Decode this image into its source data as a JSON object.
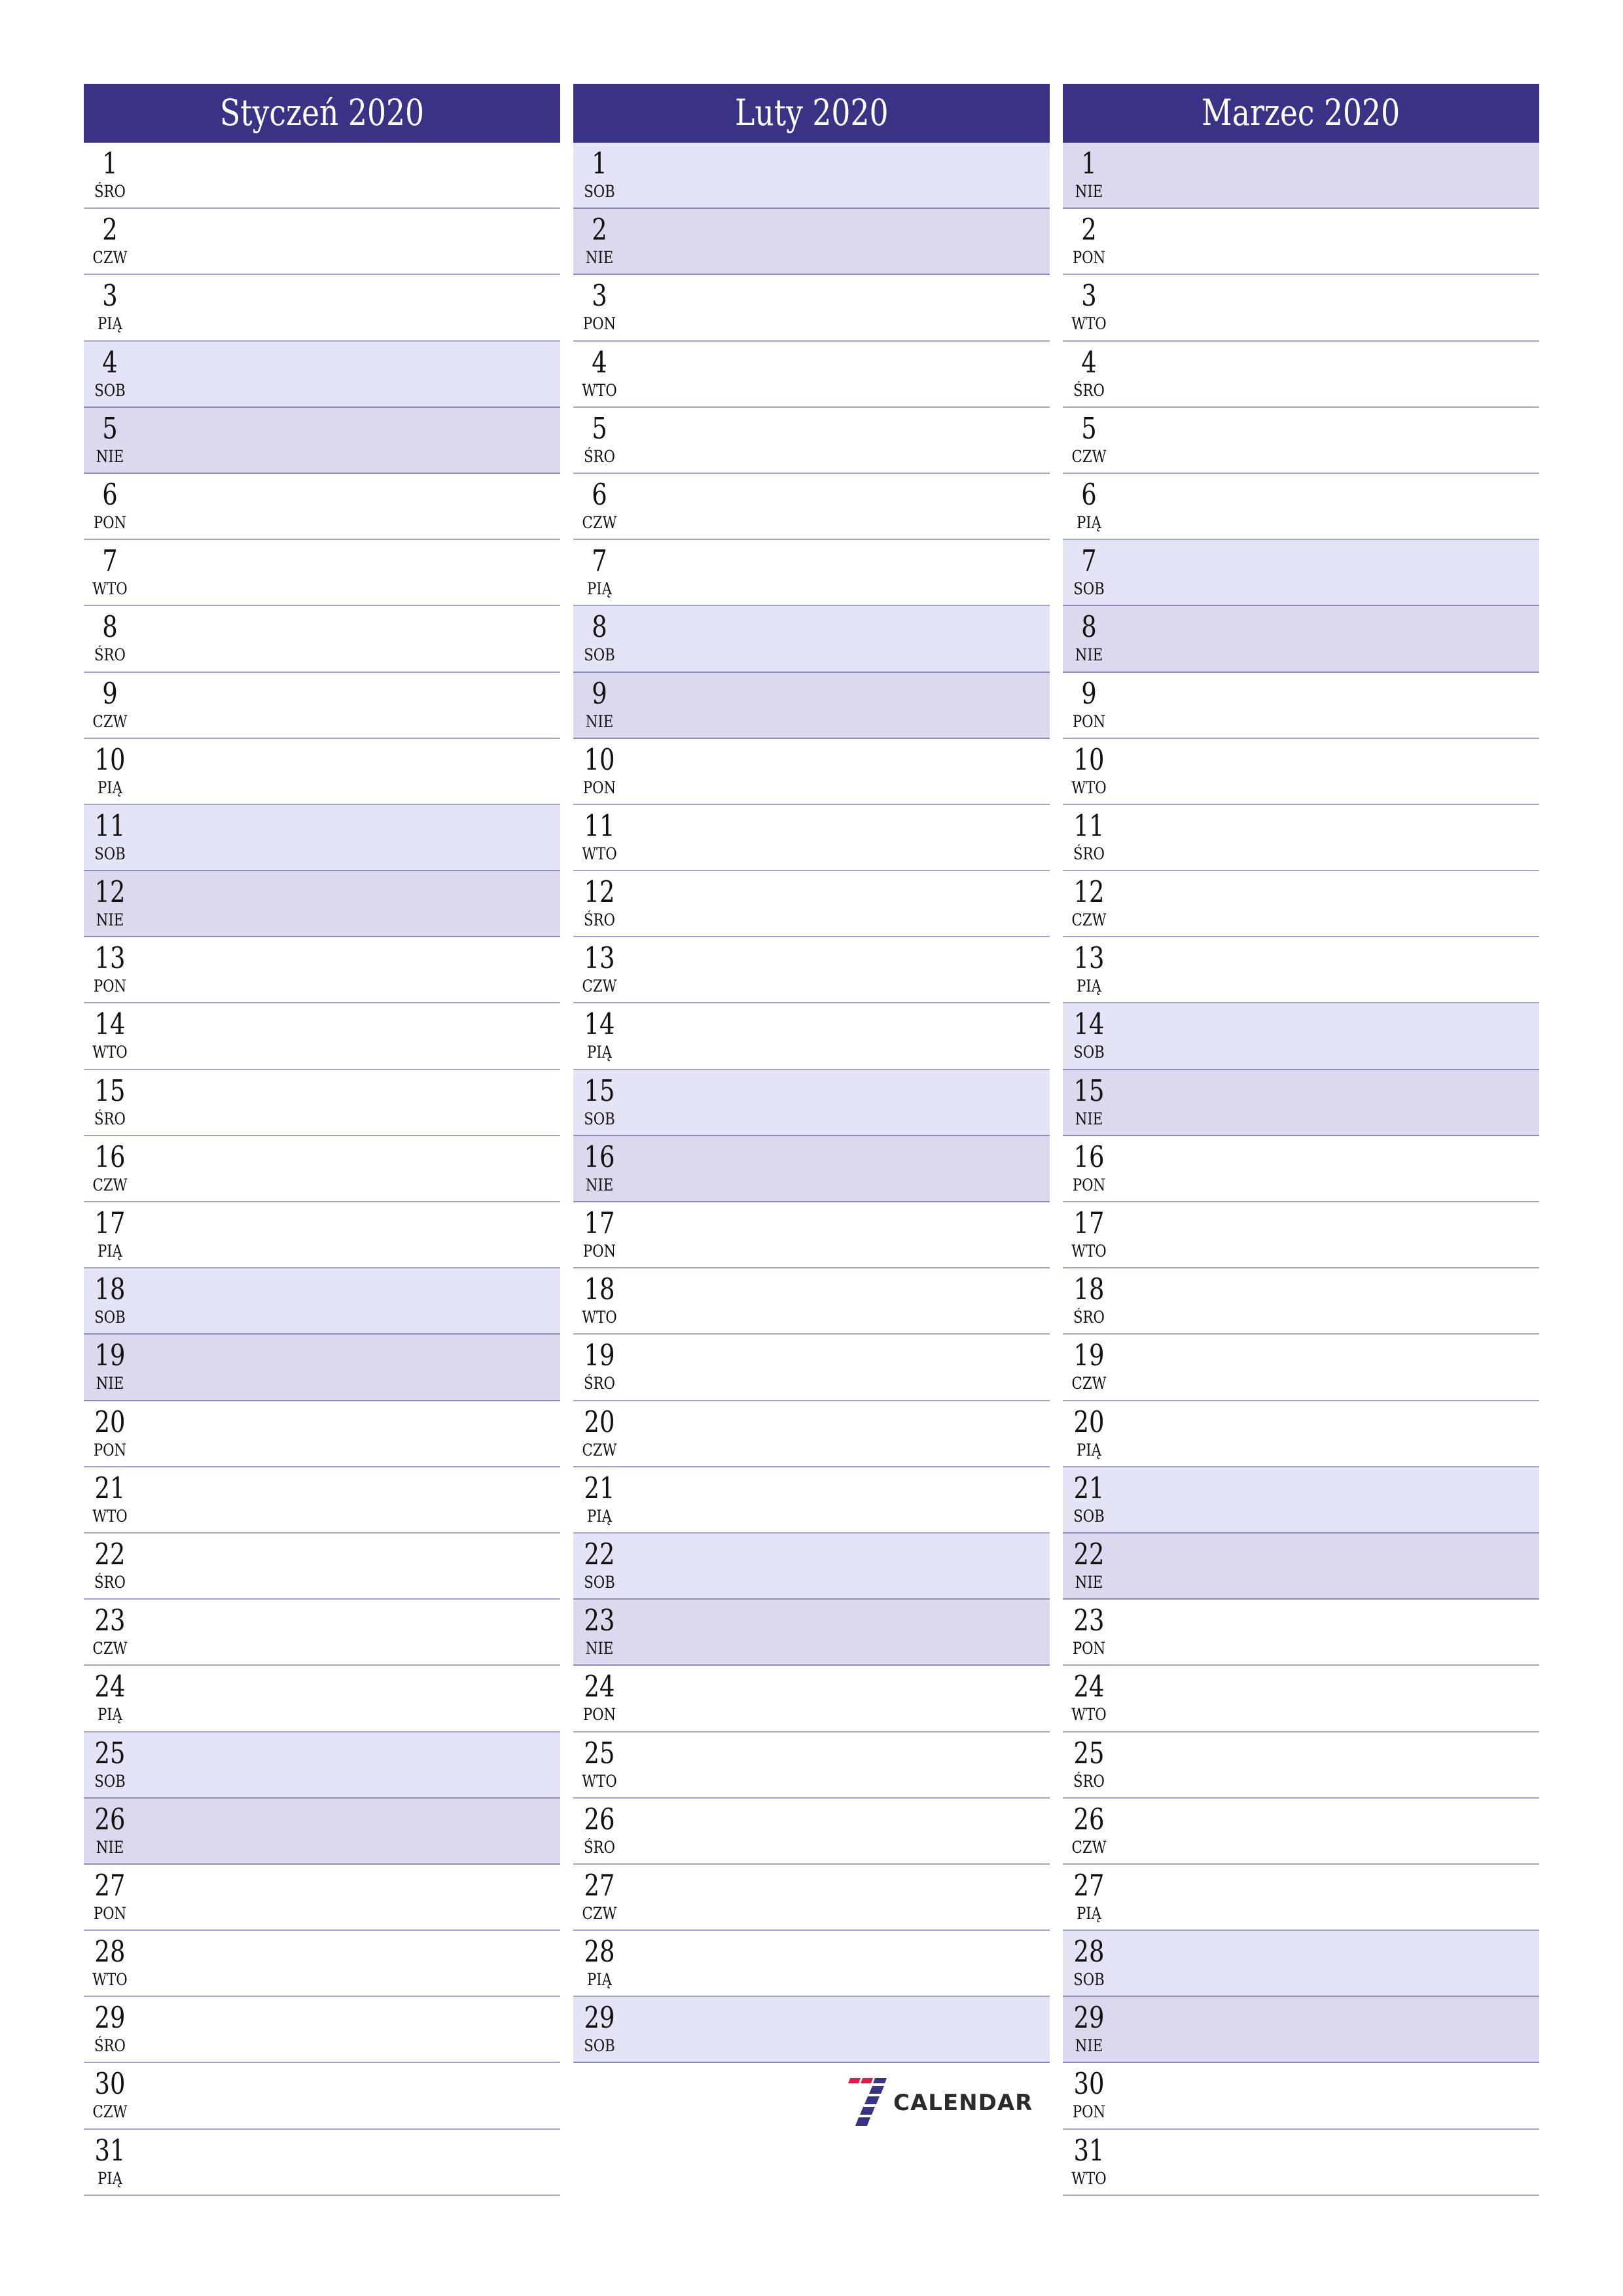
{
  "colors": {
    "header_bg": "#3A3284",
    "saturday_bg": "#E4E4F7",
    "sunday_bg": "#DCD8EE",
    "logo_red": "#E8174A",
    "logo_blue": "#3A3284"
  },
  "months": [
    {
      "title": "Styczeń 2020",
      "days": [
        {
          "n": "1",
          "d": "ŚRO"
        },
        {
          "n": "2",
          "d": "CZW"
        },
        {
          "n": "3",
          "d": "PIĄ"
        },
        {
          "n": "4",
          "d": "SOB"
        },
        {
          "n": "5",
          "d": "NIE"
        },
        {
          "n": "6",
          "d": "PON"
        },
        {
          "n": "7",
          "d": "WTO"
        },
        {
          "n": "8",
          "d": "ŚRO"
        },
        {
          "n": "9",
          "d": "CZW"
        },
        {
          "n": "10",
          "d": "PIĄ"
        },
        {
          "n": "11",
          "d": "SOB"
        },
        {
          "n": "12",
          "d": "NIE"
        },
        {
          "n": "13",
          "d": "PON"
        },
        {
          "n": "14",
          "d": "WTO"
        },
        {
          "n": "15",
          "d": "ŚRO"
        },
        {
          "n": "16",
          "d": "CZW"
        },
        {
          "n": "17",
          "d": "PIĄ"
        },
        {
          "n": "18",
          "d": "SOB"
        },
        {
          "n": "19",
          "d": "NIE"
        },
        {
          "n": "20",
          "d": "PON"
        },
        {
          "n": "21",
          "d": "WTO"
        },
        {
          "n": "22",
          "d": "ŚRO"
        },
        {
          "n": "23",
          "d": "CZW"
        },
        {
          "n": "24",
          "d": "PIĄ"
        },
        {
          "n": "25",
          "d": "SOB"
        },
        {
          "n": "26",
          "d": "NIE"
        },
        {
          "n": "27",
          "d": "PON"
        },
        {
          "n": "28",
          "d": "WTO"
        },
        {
          "n": "29",
          "d": "ŚRO"
        },
        {
          "n": "30",
          "d": "CZW"
        },
        {
          "n": "31",
          "d": "PIĄ"
        }
      ]
    },
    {
      "title": "Luty 2020",
      "days": [
        {
          "n": "1",
          "d": "SOB"
        },
        {
          "n": "2",
          "d": "NIE"
        },
        {
          "n": "3",
          "d": "PON"
        },
        {
          "n": "4",
          "d": "WTO"
        },
        {
          "n": "5",
          "d": "ŚRO"
        },
        {
          "n": "6",
          "d": "CZW"
        },
        {
          "n": "7",
          "d": "PIĄ"
        },
        {
          "n": "8",
          "d": "SOB"
        },
        {
          "n": "9",
          "d": "NIE"
        },
        {
          "n": "10",
          "d": "PON"
        },
        {
          "n": "11",
          "d": "WTO"
        },
        {
          "n": "12",
          "d": "ŚRO"
        },
        {
          "n": "13",
          "d": "CZW"
        },
        {
          "n": "14",
          "d": "PIĄ"
        },
        {
          "n": "15",
          "d": "SOB"
        },
        {
          "n": "16",
          "d": "NIE"
        },
        {
          "n": "17",
          "d": "PON"
        },
        {
          "n": "18",
          "d": "WTO"
        },
        {
          "n": "19",
          "d": "ŚRO"
        },
        {
          "n": "20",
          "d": "CZW"
        },
        {
          "n": "21",
          "d": "PIĄ"
        },
        {
          "n": "22",
          "d": "SOB"
        },
        {
          "n": "23",
          "d": "NIE"
        },
        {
          "n": "24",
          "d": "PON"
        },
        {
          "n": "25",
          "d": "WTO"
        },
        {
          "n": "26",
          "d": "ŚRO"
        },
        {
          "n": "27",
          "d": "CZW"
        },
        {
          "n": "28",
          "d": "PIĄ"
        },
        {
          "n": "29",
          "d": "SOB"
        }
      ]
    },
    {
      "title": "Marzec 2020",
      "days": [
        {
          "n": "1",
          "d": "NIE"
        },
        {
          "n": "2",
          "d": "PON"
        },
        {
          "n": "3",
          "d": "WTO"
        },
        {
          "n": "4",
          "d": "ŚRO"
        },
        {
          "n": "5",
          "d": "CZW"
        },
        {
          "n": "6",
          "d": "PIĄ"
        },
        {
          "n": "7",
          "d": "SOB"
        },
        {
          "n": "8",
          "d": "NIE"
        },
        {
          "n": "9",
          "d": "PON"
        },
        {
          "n": "10",
          "d": "WTO"
        },
        {
          "n": "11",
          "d": "ŚRO"
        },
        {
          "n": "12",
          "d": "CZW"
        },
        {
          "n": "13",
          "d": "PIĄ"
        },
        {
          "n": "14",
          "d": "SOB"
        },
        {
          "n": "15",
          "d": "NIE"
        },
        {
          "n": "16",
          "d": "PON"
        },
        {
          "n": "17",
          "d": "WTO"
        },
        {
          "n": "18",
          "d": "ŚRO"
        },
        {
          "n": "19",
          "d": "CZW"
        },
        {
          "n": "20",
          "d": "PIĄ"
        },
        {
          "n": "21",
          "d": "SOB"
        },
        {
          "n": "22",
          "d": "NIE"
        },
        {
          "n": "23",
          "d": "PON"
        },
        {
          "n": "24",
          "d": "WTO"
        },
        {
          "n": "25",
          "d": "ŚRO"
        },
        {
          "n": "26",
          "d": "CZW"
        },
        {
          "n": "27",
          "d": "PIĄ"
        },
        {
          "n": "28",
          "d": "SOB"
        },
        {
          "n": "29",
          "d": "NIE"
        },
        {
          "n": "30",
          "d": "PON"
        },
        {
          "n": "31",
          "d": "WTO"
        }
      ]
    }
  ],
  "weekend_labels": {
    "saturday": "SOB",
    "sunday": "NIE"
  },
  "logo": {
    "icon": "seven-logo-icon",
    "text": "CALENDAR"
  }
}
